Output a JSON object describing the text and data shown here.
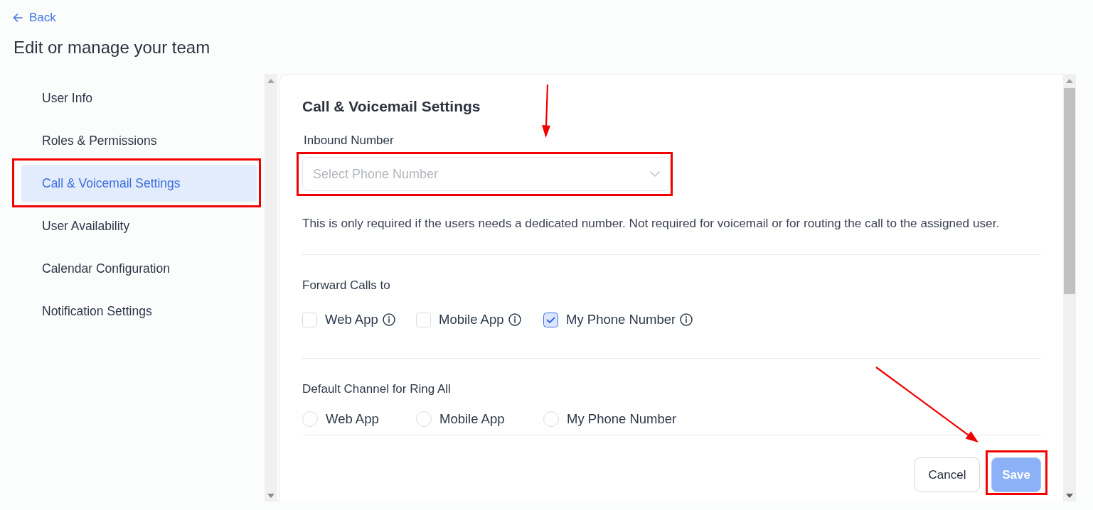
{
  "back_link": {
    "label": "Back"
  },
  "page_title": "Edit or manage your team",
  "sidebar": {
    "items": [
      {
        "label": "User Info",
        "selected": false,
        "highlighted": false
      },
      {
        "label": "Roles & Permissions",
        "selected": false,
        "highlighted": false
      },
      {
        "label": "Call & Voicemail Settings",
        "selected": true,
        "highlighted": true
      },
      {
        "label": "User Availability",
        "selected": false,
        "highlighted": false
      },
      {
        "label": "Calendar Configuration",
        "selected": false,
        "highlighted": false
      },
      {
        "label": "Notification Settings",
        "selected": false,
        "highlighted": false
      }
    ]
  },
  "panel": {
    "title": "Call & Voicemail Settings",
    "inbound_number": {
      "label": "Inbound Number",
      "placeholder": "Select Phone Number",
      "highlighted": true
    },
    "help_text": "This is only required if the users needs a dedicated number. Not required for voicemail or for routing the call to the assigned user.",
    "forward_calls": {
      "label": "Forward Calls to",
      "options": [
        {
          "label": "Web App",
          "checked": false
        },
        {
          "label": "Mobile App",
          "checked": false
        },
        {
          "label": "My Phone Number",
          "checked": true
        }
      ]
    },
    "default_channel": {
      "label": "Default Channel for Ring All",
      "options": [
        {
          "label": "Web App",
          "selected": false
        },
        {
          "label": "Mobile App",
          "selected": false
        },
        {
          "label": "My Phone Number",
          "selected": false
        }
      ]
    }
  },
  "buttons": [
    {
      "label": "Cancel",
      "kind": "secondary",
      "disabled": false,
      "highlighted": false
    },
    {
      "label": "Save",
      "kind": "primary",
      "disabled": true,
      "highlighted": true
    }
  ]
}
